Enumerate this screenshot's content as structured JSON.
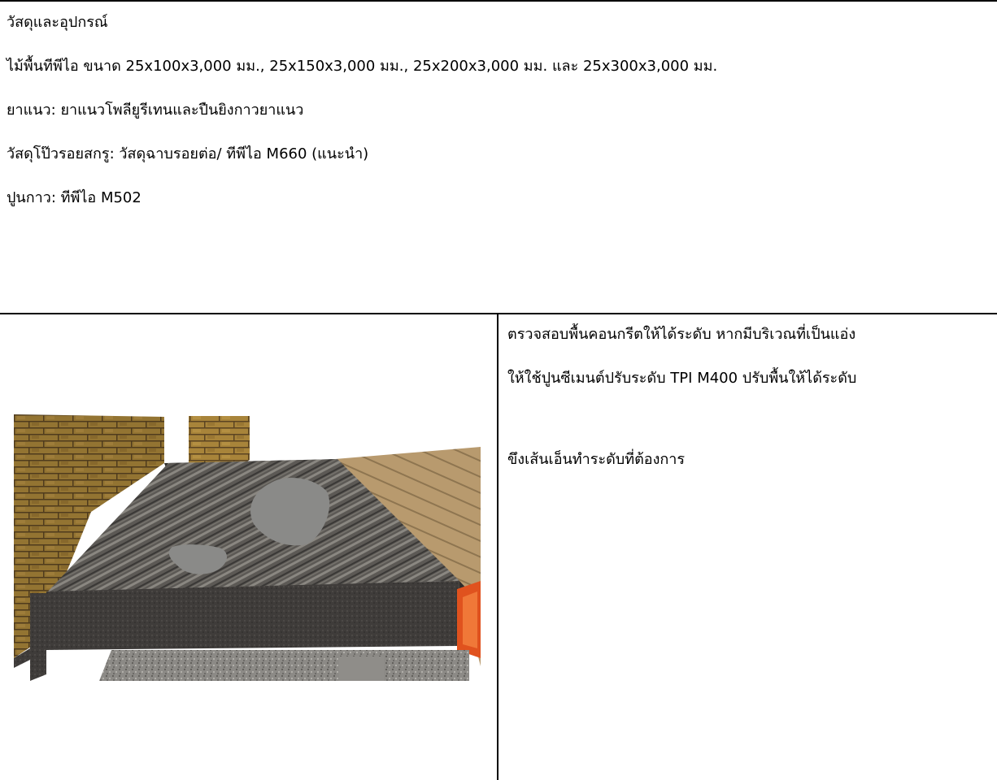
{
  "materials": {
    "heading": "วัสดุและอุปกรณ์",
    "lines": [
      "ไม้พื้นทีพีไอ ขนาด 25x100x3,000 มม., 25x150x3,000 มม., 25x200x3,000 มม. และ 25x300x3,000 มม.",
      "ยาแนว:  ยาแนวโพลียูรีเทนและปืนยิงกาวยาแนว",
      "วัสดุโป๊วรอยสกรู:   วัสดุฉาบรอยต่อ/ ทีพีไอ M660 (แนะนำ)",
      "ปูนกาว:  ทีพีไอ M502"
    ]
  },
  "step": {
    "instruction_lines": [
      "ตรวจสอบพื้นคอนกรีตให้ได้ระดับ หากมีบริเวณที่เป็นแอ่ง",
      "ให้ใช้ปูนซีเมนต์ปรับระดับ TPI M400 ปรับพื้นให้ได้ระดับ"
    ],
    "note": "ขึงเส้นเอ็นทำระดับที่ต้องการ"
  },
  "colors": {
    "brick": "#a8843a",
    "slab_top": "#5e5a55",
    "slab_edge": "#3f3c3a",
    "patch": "#8a8a88",
    "wood": "#b89a6e",
    "orange": "#e0521e"
  }
}
